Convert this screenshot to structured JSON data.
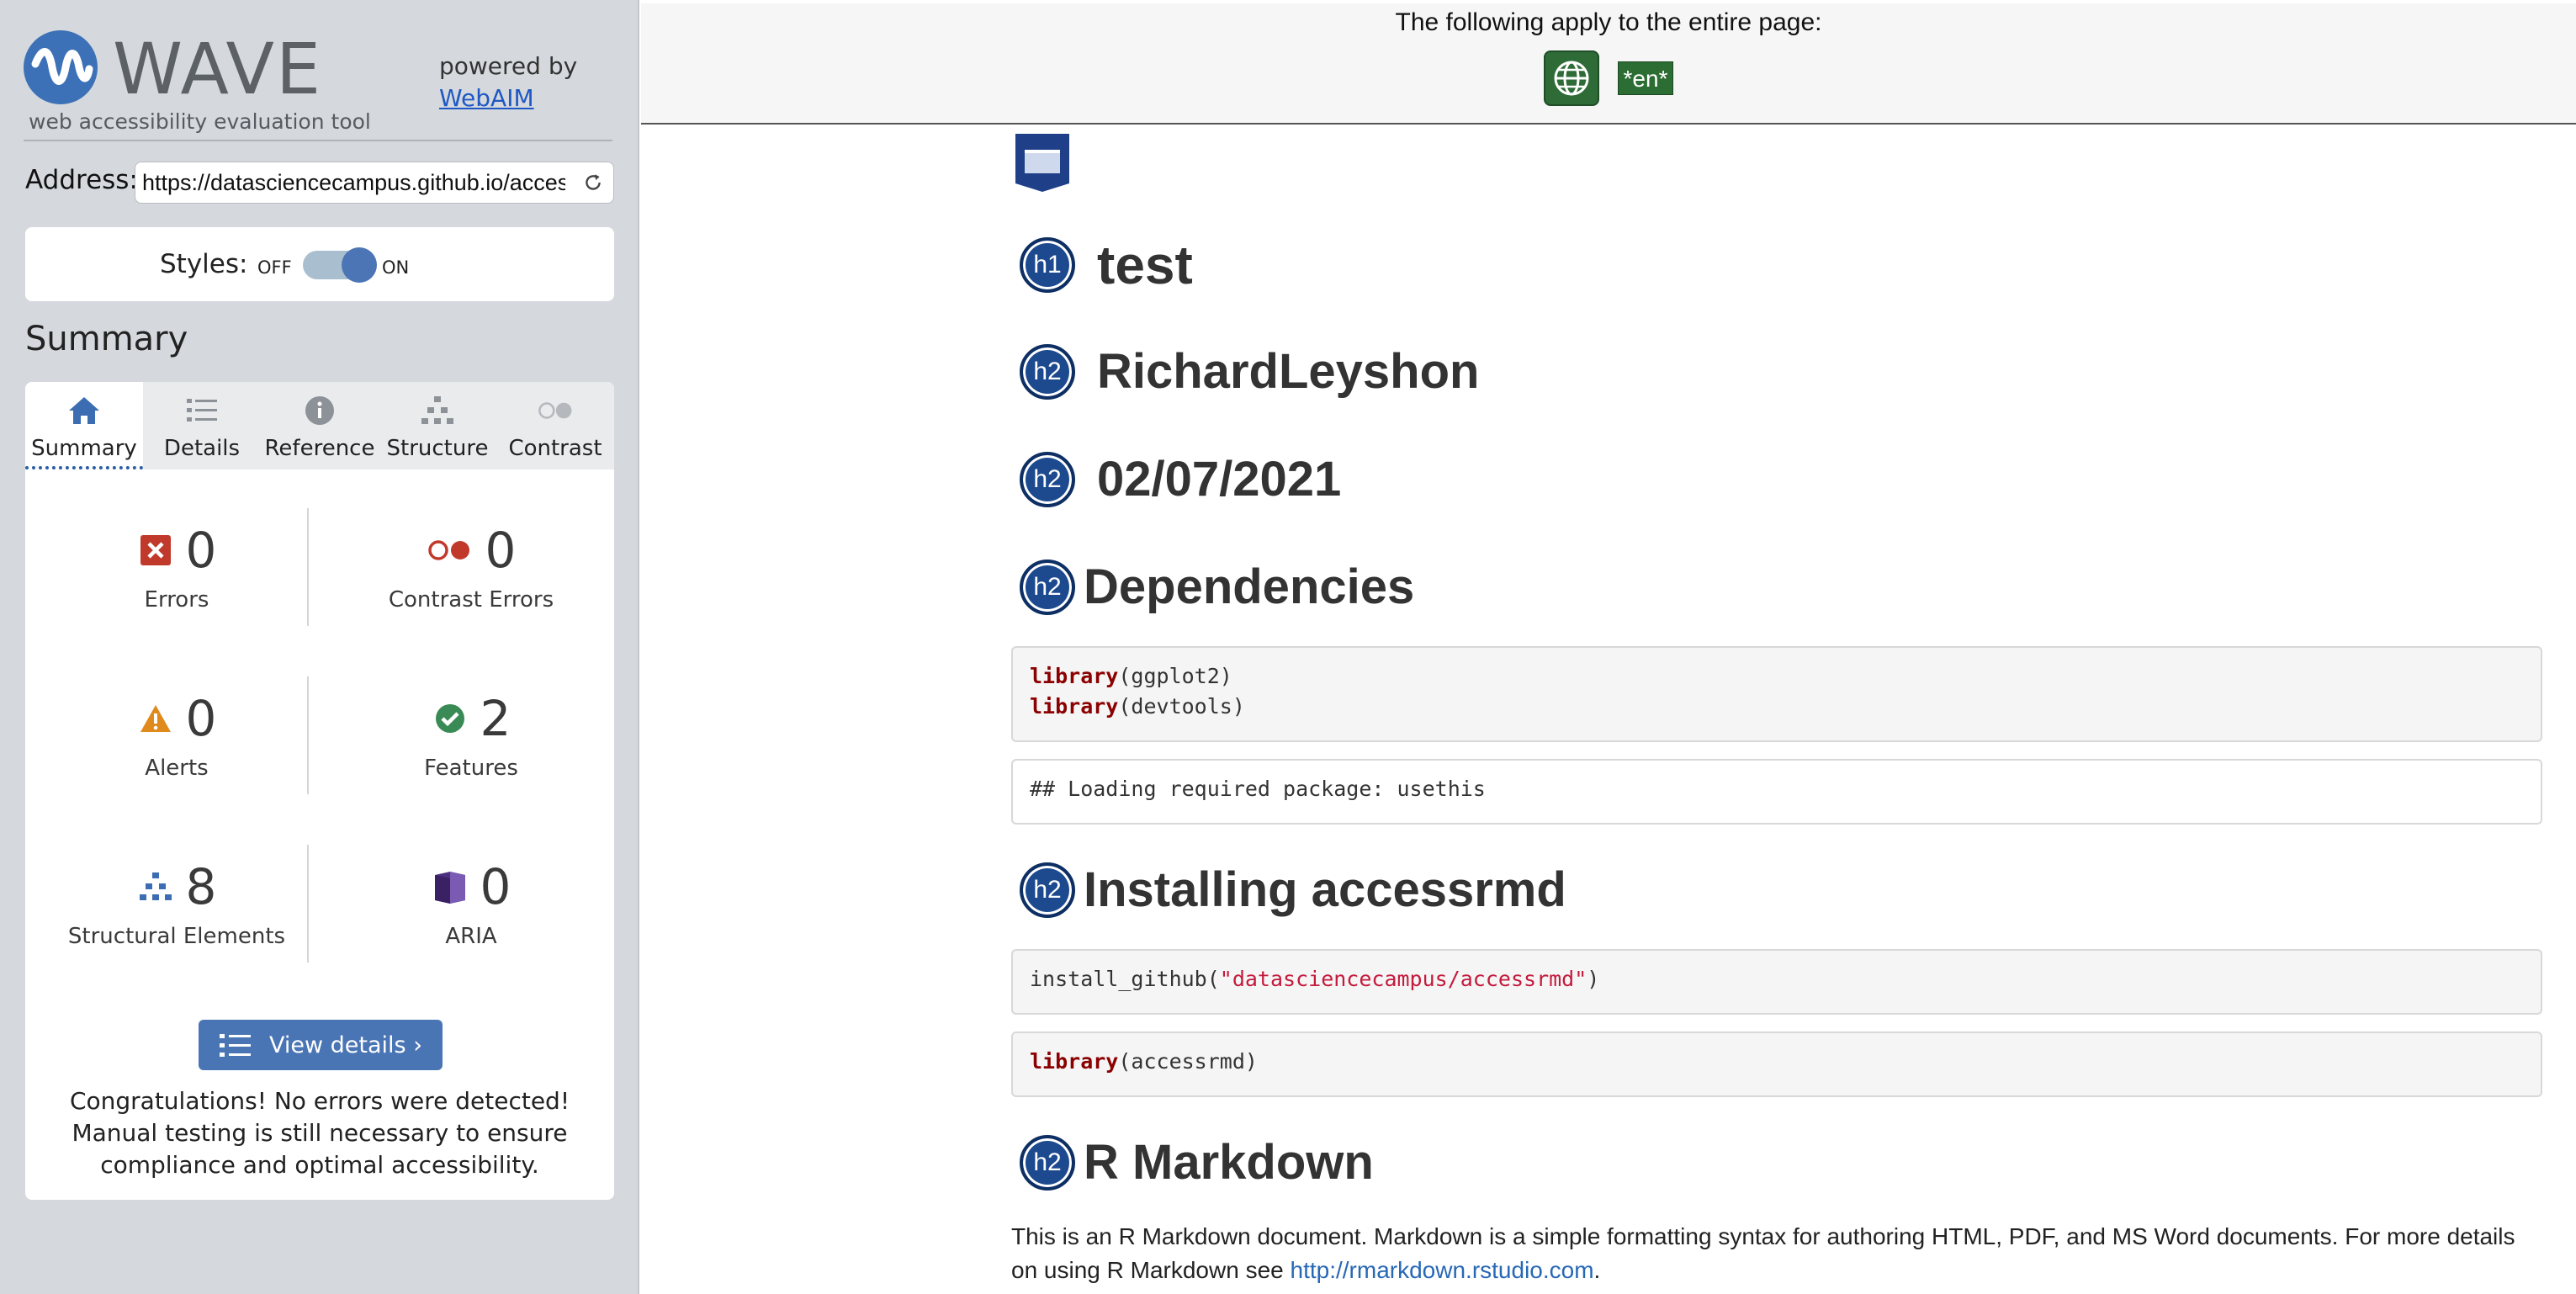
{
  "sidebar": {
    "brand": {
      "name": "WAVE",
      "tagline": "web accessibility evaluation tool",
      "powered_by": "powered by",
      "powered_link": "WebAIM"
    },
    "address": {
      "label": "Address:",
      "value": "https://datasciencecampus.github.io/accessrmd"
    },
    "styles": {
      "label": "Styles:",
      "off": "OFF",
      "on": "ON",
      "state": "on"
    },
    "summary_title": "Summary",
    "tabs": [
      {
        "label": "Summary",
        "icon": "home-icon",
        "active": true
      },
      {
        "label": "Details",
        "icon": "list-icon",
        "active": false
      },
      {
        "label": "Reference",
        "icon": "info-icon",
        "active": false
      },
      {
        "label": "Structure",
        "icon": "hierarchy-icon",
        "active": false
      },
      {
        "label": "Contrast",
        "icon": "contrast-icon",
        "active": false
      }
    ],
    "stats": {
      "errors": {
        "value": "0",
        "label": "Errors"
      },
      "contrast_errors": {
        "value": "0",
        "label": "Contrast Errors"
      },
      "alerts": {
        "value": "0",
        "label": "Alerts"
      },
      "features": {
        "value": "2",
        "label": "Features"
      },
      "structural": {
        "value": "8",
        "label": "Structural Elements"
      },
      "aria": {
        "value": "0",
        "label": "ARIA"
      }
    },
    "view_details": "View details ›",
    "congrats": "Congratulations! No errors were detected! Manual testing is still necessary to ensure compliance and optimal accessibility."
  },
  "main": {
    "banner_text": "The following apply to the entire page:",
    "lang_tag": "*en*",
    "headings": {
      "title": {
        "level": "h1",
        "text": "test"
      },
      "author": {
        "level": "h2",
        "text": "RichardLeyshon"
      },
      "date": {
        "level": "h2",
        "text": "02/07/2021"
      },
      "dependencies": {
        "level": "h2",
        "text": "Dependencies"
      },
      "installing": {
        "level": "h2",
        "text": "Installing accessrmd"
      },
      "rmarkdown": {
        "level": "h2",
        "text": "R Markdown"
      }
    },
    "code": {
      "deps_kw1": "library",
      "deps_arg1": "(ggplot2)",
      "deps_kw2": "library",
      "deps_arg2": "(devtools)",
      "deps_output": "## Loading required package: usethis",
      "install_fn": "install_github(",
      "install_str": "\"datasciencecampus/accessrmd\"",
      "install_close": ")",
      "lib_kw": "library",
      "lib_arg": "(accessrmd)"
    },
    "paragraph": {
      "text": "This is an R Markdown document. Markdown is a simple formatting syntax for authoring HTML, PDF, and MS Word documents. For more details on using R Markdown see ",
      "link": "http://rmarkdown.rstudio.com",
      "end": "."
    }
  },
  "colors": {
    "sidebar_bg": "#d5d9dd",
    "accent_blue": "#4a75b4",
    "error_red": "#c0392b",
    "alert_orange": "#e08a1e",
    "feature_green": "#3a8a55",
    "aria_purple": "#4b2f7e",
    "heading_badge": "#1d4a8f",
    "lang_green": "#2c6d33"
  }
}
